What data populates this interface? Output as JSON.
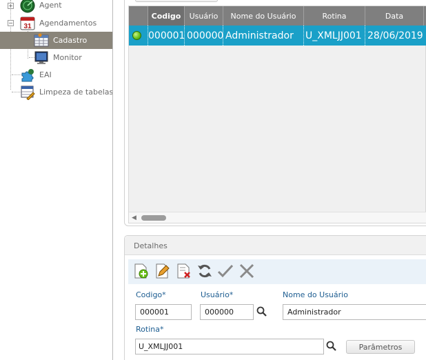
{
  "tree": {
    "items": [
      {
        "label": "Agent",
        "icon": "radar-icon"
      },
      {
        "label": "Agendamentos",
        "icon": "calendar-31-icon"
      },
      {
        "label": "Cadastro",
        "icon": "table-grid-icon",
        "selected": true
      },
      {
        "label": "Monitor",
        "icon": "monitor-icon"
      },
      {
        "label": "EAI",
        "icon": "puzzle-icon"
      },
      {
        "label": "Limpeza de tabelas",
        "icon": "clean-table-icon"
      }
    ]
  },
  "grid": {
    "columns": [
      "",
      "Codigo",
      "Usuário",
      "Nome do Usuário",
      "Rotina",
      "Data"
    ],
    "rows": [
      {
        "status": "active",
        "codigo": "000001",
        "usuario": "000000",
        "nome": "Administrador",
        "rotina": "U_XMLJJ001",
        "data": "28/06/2019"
      }
    ]
  },
  "details": {
    "title": "Detalhes",
    "toolbar": [
      "add-doc-icon",
      "edit-doc-icon",
      "delete-doc-icon",
      "refresh-icon",
      "confirm-icon",
      "cancel-icon"
    ],
    "fields": {
      "codigo": {
        "label": "Codigo*",
        "value": "000001"
      },
      "usuario": {
        "label": "Usuário*",
        "value": "000000"
      },
      "nome": {
        "label": "Nome do Usuário",
        "value": "Administrador"
      },
      "rotina": {
        "label": "Rotina*",
        "value": "U_XMLJJ001"
      }
    },
    "params_button": "Parâmetros"
  },
  "colors": {
    "selected_row": "#1aa0c8",
    "selected_tree": "#8a857a",
    "label": "#1c5c90",
    "header": "#7f7f7f"
  }
}
